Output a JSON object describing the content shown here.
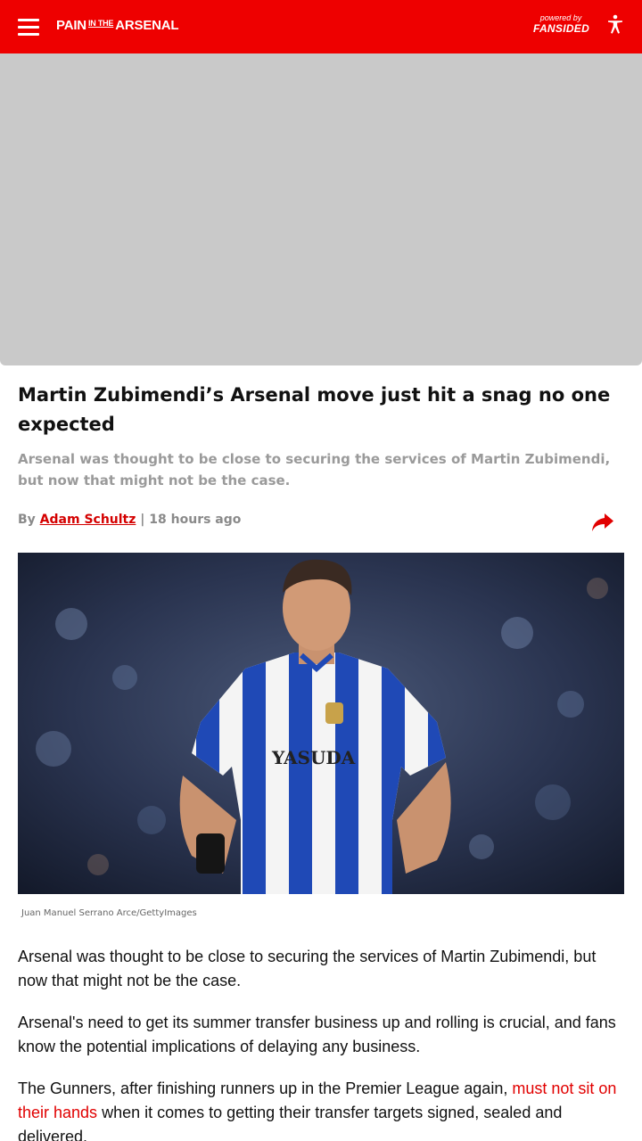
{
  "header": {
    "brand": {
      "left": "PAIN",
      "middle": "IN THE",
      "right": "ARSENAL"
    },
    "powered_by": "powered by",
    "network": "FANSIDED",
    "brand_color": "#ee0000"
  },
  "article": {
    "headline": "Martin Zubimendi’s Arsenal move just hit a snag no one expected",
    "dek": "Arsenal was thought to be close to securing the services of Martin Zubimendi, but now that might not be the case.",
    "byline_prefix": "By",
    "author": "Adam Schultz",
    "separator": "|",
    "time_ago": "18 hours ago",
    "image_credit": "Juan Manuel Serrano Arce/GettyImages",
    "hero_shirt_sponsor": "YASUDA",
    "paragraphs": {
      "p1": "Arsenal was thought to be close to securing the services of Martin Zubimendi, but now that might not be the case.",
      "p2": "Arsenal's need to get its summer transfer business up and rolling is crucial, and fans know the potential implications of delaying any business.",
      "p3_before": "The Gunners, after finishing runners up in the Premier League again, ",
      "p3_link": "must not sit on their hands",
      "p3_after": " when it comes to getting their transfer targets signed, sealed and delivered."
    }
  },
  "icons": {
    "menu": "hamburger-menu-icon",
    "accessibility": "accessibility-icon",
    "share": "share-arrow-icon"
  },
  "colors": {
    "link": "#e10000",
    "dek": "#9a9a9a",
    "ad_placeholder": "#c9c9c9"
  }
}
